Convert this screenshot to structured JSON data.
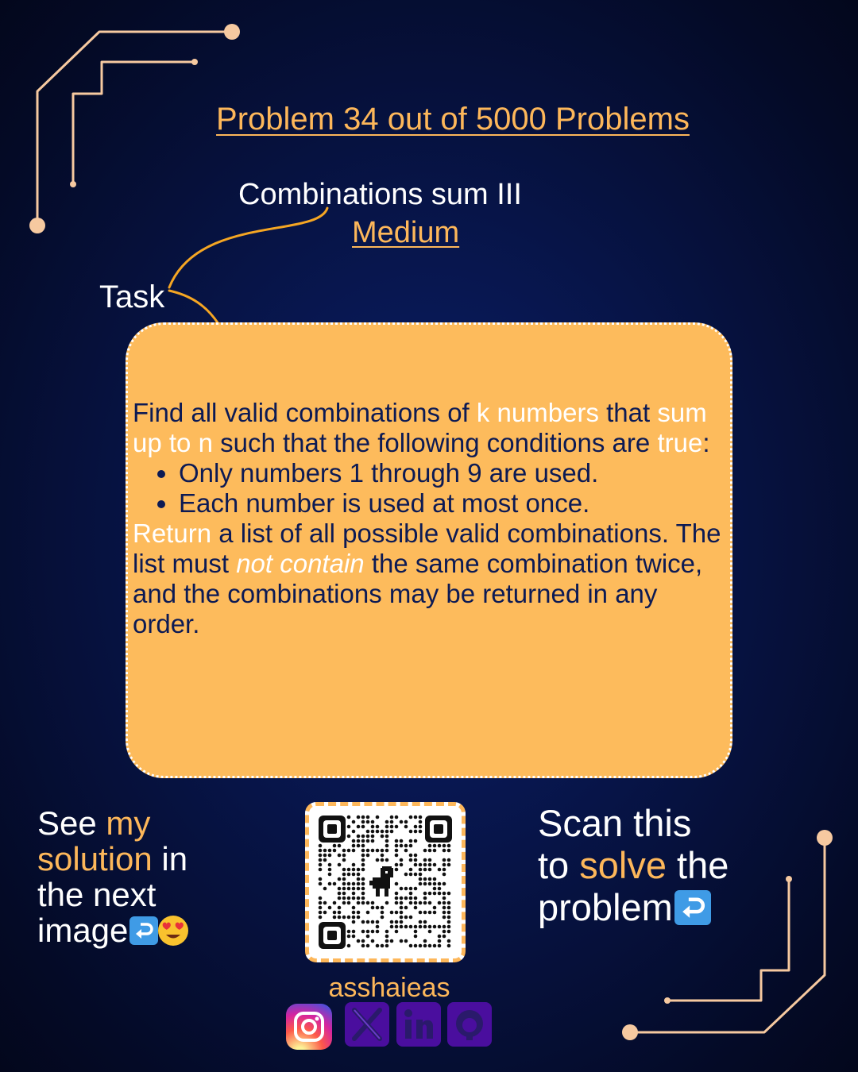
{
  "header": {
    "headline": "Problem 34 out of 5000 Problems",
    "problem_title": "Combinations sum III",
    "difficulty": "Medium",
    "task_label": "Task"
  },
  "task": {
    "intro": {
      "p1": "Find all valid combinations of ",
      "h1": "k numbers",
      "p2": " that ",
      "h2": "sum up to n",
      "p3": " such that the following conditions are ",
      "h3": "true",
      "p4": ":"
    },
    "conditions": [
      "Only numbers 1 through 9 are used.",
      "Each number is used at most once."
    ],
    "outro": {
      "h1": "Return",
      "p1": " a list of all possible valid combinations. The list must ",
      "em": "not contain",
      "p2": " the same combination twice, and the combinations may be returned in any order."
    }
  },
  "left_callout": {
    "w1": "See ",
    "w2": "my",
    "w3": "solution",
    "w4": " in",
    "w5": "the next",
    "w6": "image"
  },
  "right_callout": {
    "w1": "Scan this",
    "w2": " to ",
    "w3": "solve",
    "w4": " the",
    "w5": "problem"
  },
  "footer": {
    "username": "asshaieas",
    "socials": [
      "instagram-icon",
      "x-icon",
      "linkedin-icon",
      "github-icon"
    ]
  },
  "colors": {
    "background": "#071447",
    "accent": "#fdb75a",
    "card": "#fdbb5c",
    "card_text": "#0c1a54",
    "social_tile": "#4a0e9e",
    "return_icon": "#3f9be6"
  }
}
